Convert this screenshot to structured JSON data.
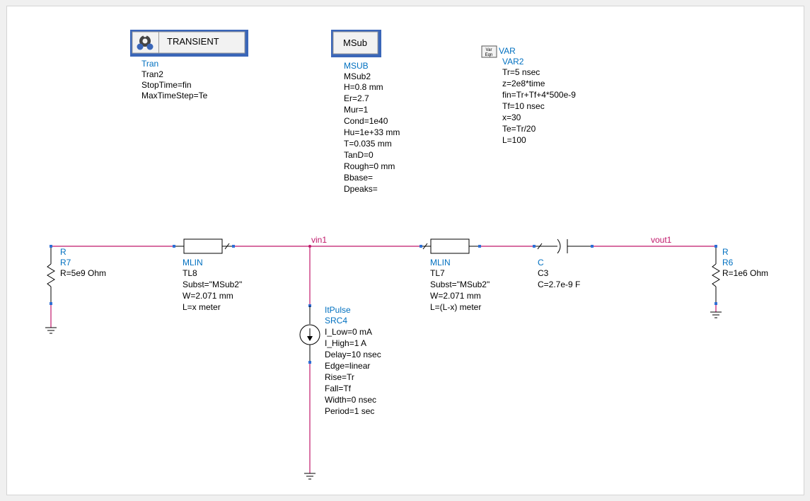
{
  "tran": {
    "button_label": "TRANSIENT",
    "type": "Tran",
    "name": "Tran2",
    "params": [
      "StopTime=fin",
      "MaxTimeStep=Te"
    ]
  },
  "msub": {
    "button_label": "MSub",
    "type": "MSUB",
    "name": "MSub2",
    "params": [
      "H=0.8 mm",
      "Er=2.7",
      "Mur=1",
      "Cond=1e40",
      "Hu=1e+33 mm",
      "T=0.035 mm",
      "TanD=0",
      "Rough=0 mm",
      "Bbase=",
      "Dpeaks="
    ]
  },
  "var": {
    "icon_text": [
      "Var",
      "Eqn"
    ],
    "type": "VAR",
    "name": "VAR2",
    "params": [
      "Tr=5 nsec",
      "z=2e8*time",
      "fin=Tr+Tf+4*500e-9",
      "Tf=10 nsec",
      "x=30",
      "Te=Tr/20",
      "L=100"
    ]
  },
  "r7": {
    "type": "R",
    "name": "R7",
    "params": [
      "R=5e9 Ohm"
    ]
  },
  "tl8": {
    "type": "MLIN",
    "name": "TL8",
    "params": [
      "Subst=\"MSub2\"",
      "W=2.071 mm",
      "L=x meter"
    ]
  },
  "tl7": {
    "type": "MLIN",
    "name": "TL7",
    "params": [
      "Subst=\"MSub2\"",
      "W=2.071 mm",
      "L=(L-x) meter"
    ]
  },
  "c3": {
    "type": "C",
    "name": "C3",
    "params": [
      "C=2.7e-9 F"
    ]
  },
  "r6": {
    "type": "R",
    "name": "R6",
    "params": [
      "R=1e6 Ohm"
    ]
  },
  "src4": {
    "type": "ItPulse",
    "name": "SRC4",
    "params": [
      "I_Low=0 mA",
      "I_High=1 A",
      "Delay=10 nsec",
      "Edge=linear",
      "Rise=Tr",
      "Fall=Tf",
      "Width=0 nsec",
      "Period=1 sec"
    ]
  },
  "nodes": {
    "vin": "vin1",
    "vout": "vout1"
  },
  "colors": {
    "wire": "#c0186a",
    "label": "#0070c0",
    "pin": "#2e6fd6"
  }
}
